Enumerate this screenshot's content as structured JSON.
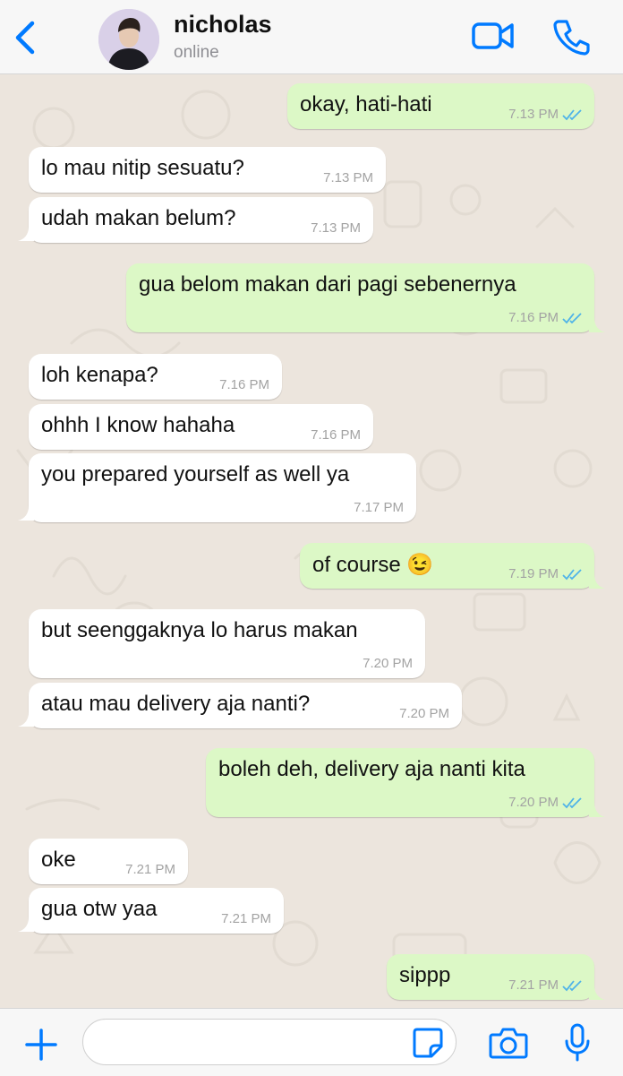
{
  "header": {
    "contact_name": "nicholas",
    "contact_status": "online",
    "icons": [
      "chevron-left-icon",
      "video-camera-icon",
      "phone-icon"
    ],
    "accent_color": "#007aff"
  },
  "messages": [
    {
      "dir": "out",
      "text": "okay, hati-hati",
      "time": "7.13 PM"
    },
    {
      "dir": "in",
      "text": "lo mau nitip sesuatu?",
      "time": "7.13 PM"
    },
    {
      "dir": "in",
      "text": "udah makan belum?",
      "time": "7.13 PM"
    },
    {
      "dir": "out",
      "text": "gua belom makan dari pagi sebenernya",
      "time": "7.16 PM"
    },
    {
      "dir": "in",
      "text": "loh kenapa?",
      "time": "7.16 PM"
    },
    {
      "dir": "in",
      "text": "ohhh I know hahaha",
      "time": "7.16 PM"
    },
    {
      "dir": "in",
      "text": "you prepared yourself as well ya",
      "time": "7.17 PM"
    },
    {
      "dir": "out",
      "text": "of course 😉",
      "time": "7.19 PM"
    },
    {
      "dir": "in",
      "text": "but seenggaknya lo harus makan",
      "time": "7.20 PM"
    },
    {
      "dir": "in",
      "text": "atau mau delivery aja nanti?",
      "time": "7.20 PM"
    },
    {
      "dir": "out",
      "text": "boleh deh, delivery aja nanti kita",
      "time": "7.20 PM"
    },
    {
      "dir": "in",
      "text": "oke",
      "time": "7.21 PM"
    },
    {
      "dir": "in",
      "text": "gua otw yaa",
      "time": "7.21 PM"
    },
    {
      "dir": "out",
      "text": "sippp",
      "time": "7.21 PM"
    }
  ],
  "input": {
    "value": "",
    "icons": [
      "plus-icon",
      "sticker-icon",
      "camera-icon",
      "microphone-icon"
    ]
  },
  "colors": {
    "incoming_bubble": "#ffffff",
    "outgoing_bubble": "#dcf8c6",
    "read_ticks": "#4fb3e8",
    "wallpaper": "#ece5dd"
  }
}
